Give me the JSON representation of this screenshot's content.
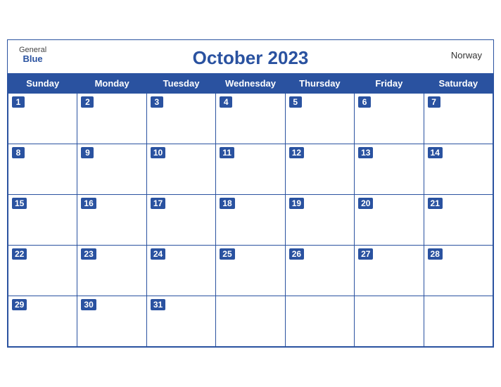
{
  "header": {
    "logo_general": "General",
    "logo_blue": "Blue",
    "title": "October 2023",
    "country": "Norway"
  },
  "weekdays": [
    "Sunday",
    "Monday",
    "Tuesday",
    "Wednesday",
    "Thursday",
    "Friday",
    "Saturday"
  ],
  "weeks": [
    [
      {
        "day": 1,
        "empty": false
      },
      {
        "day": 2,
        "empty": false
      },
      {
        "day": 3,
        "empty": false
      },
      {
        "day": 4,
        "empty": false
      },
      {
        "day": 5,
        "empty": false
      },
      {
        "day": 6,
        "empty": false
      },
      {
        "day": 7,
        "empty": false
      }
    ],
    [
      {
        "day": 8,
        "empty": false
      },
      {
        "day": 9,
        "empty": false
      },
      {
        "day": 10,
        "empty": false
      },
      {
        "day": 11,
        "empty": false
      },
      {
        "day": 12,
        "empty": false
      },
      {
        "day": 13,
        "empty": false
      },
      {
        "day": 14,
        "empty": false
      }
    ],
    [
      {
        "day": 15,
        "empty": false
      },
      {
        "day": 16,
        "empty": false
      },
      {
        "day": 17,
        "empty": false
      },
      {
        "day": 18,
        "empty": false
      },
      {
        "day": 19,
        "empty": false
      },
      {
        "day": 20,
        "empty": false
      },
      {
        "day": 21,
        "empty": false
      }
    ],
    [
      {
        "day": 22,
        "empty": false
      },
      {
        "day": 23,
        "empty": false
      },
      {
        "day": 24,
        "empty": false
      },
      {
        "day": 25,
        "empty": false
      },
      {
        "day": 26,
        "empty": false
      },
      {
        "day": 27,
        "empty": false
      },
      {
        "day": 28,
        "empty": false
      }
    ],
    [
      {
        "day": 29,
        "empty": false
      },
      {
        "day": 30,
        "empty": false
      },
      {
        "day": 31,
        "empty": false
      },
      {
        "day": null,
        "empty": true
      },
      {
        "day": null,
        "empty": true
      },
      {
        "day": null,
        "empty": true
      },
      {
        "day": null,
        "empty": true
      }
    ]
  ]
}
